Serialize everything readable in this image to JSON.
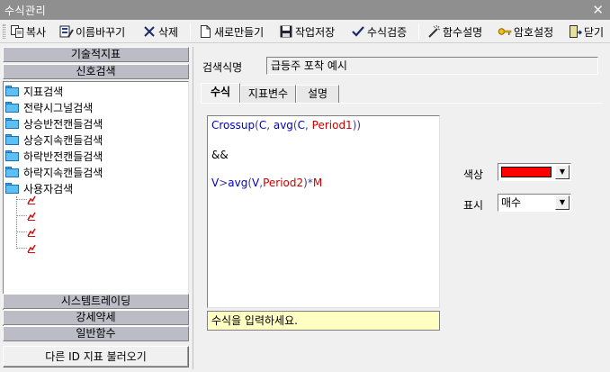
{
  "window": {
    "title": "수식관리",
    "close_glyph": "✕"
  },
  "toolbar": {
    "copy": "복사",
    "rename": "이름바꾸기",
    "delete": "삭제",
    "new": "새로만들기",
    "save": "작업저장",
    "verify": "수식검증",
    "func_help": "함수설명",
    "password": "암호설정",
    "close": "닫기"
  },
  "left": {
    "categories_top": [
      "기술적지표",
      "신호검색"
    ],
    "tree": [
      "지표검색",
      "전략시그널검색",
      "상승반전캔들검색",
      "상승지속캔들검색",
      "하락반전캔들검색",
      "하락지속캔들검색",
      "사용자검색"
    ],
    "categories_bottom": [
      "시스템트레이딩",
      "강세약세",
      "일반함수"
    ],
    "other_button": "다른 ID 지표 불러오기"
  },
  "right": {
    "name_label": "검색식명",
    "name_value": "급등주 포착 예시",
    "tabs": [
      "수식",
      "지표변수",
      "설명"
    ],
    "active_tab": "수식",
    "formula": {
      "line1": {
        "fn": "Crossup",
        "p1": "(",
        "a1": "C",
        "c1": ", ",
        "fn2": "avg",
        "p2": "(",
        "a2": "C",
        "c2": ", ",
        "v1": "Period1",
        "p3": "))"
      },
      "line2": "&&",
      "line3": {
        "a1": "V",
        "op": ">",
        "fn": "avg",
        "p1": "(",
        "a2": "V",
        "c1": ",",
        "v1": "Period2",
        "p2": ")",
        "op2": "*",
        "v2": "M"
      }
    },
    "hint": "수식을 입력하세요.",
    "color_label": "색상",
    "color_value": "#ff0000",
    "display_label": "표시",
    "display_value": "매수"
  },
  "colors": {
    "formula_fn": "#0000c8",
    "formula_var": "#c80000",
    "formula_text": "#3c3c8c"
  }
}
